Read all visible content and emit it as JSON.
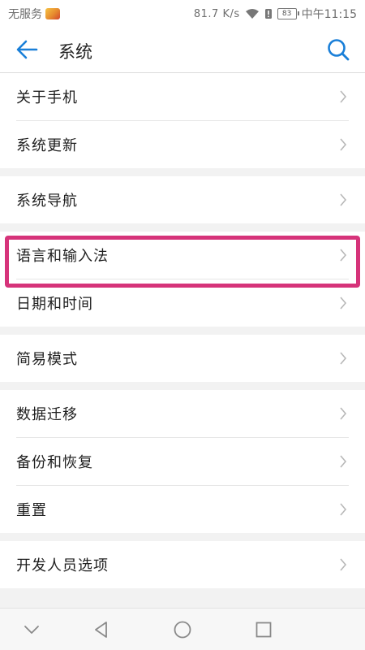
{
  "status_bar": {
    "carrier": "无服务",
    "speed": "81.7 K/s",
    "battery": "83",
    "time": "中午11:15"
  },
  "toolbar": {
    "title": "系统",
    "icons": {
      "back": "arrow-left-icon",
      "search": "search-icon"
    }
  },
  "colors": {
    "accent": "#1a7fd8",
    "highlight": "#d6337a"
  },
  "groups": [
    {
      "items": [
        {
          "label": "关于手机"
        },
        {
          "label": "系统更新"
        }
      ]
    },
    {
      "items": [
        {
          "label": "系统导航"
        }
      ]
    },
    {
      "items": [
        {
          "label": "语言和输入法"
        },
        {
          "label": "日期和时间"
        }
      ]
    },
    {
      "items": [
        {
          "label": "简易模式"
        }
      ]
    },
    {
      "items": [
        {
          "label": "数据迁移"
        },
        {
          "label": "备份和恢复"
        },
        {
          "label": "重置"
        }
      ]
    },
    {
      "items": [
        {
          "label": "开发人员选项"
        }
      ]
    }
  ],
  "nav_bar": {
    "icons": [
      "collapse-down-icon",
      "back-triangle-icon",
      "home-circle-icon",
      "recents-square-icon"
    ]
  }
}
